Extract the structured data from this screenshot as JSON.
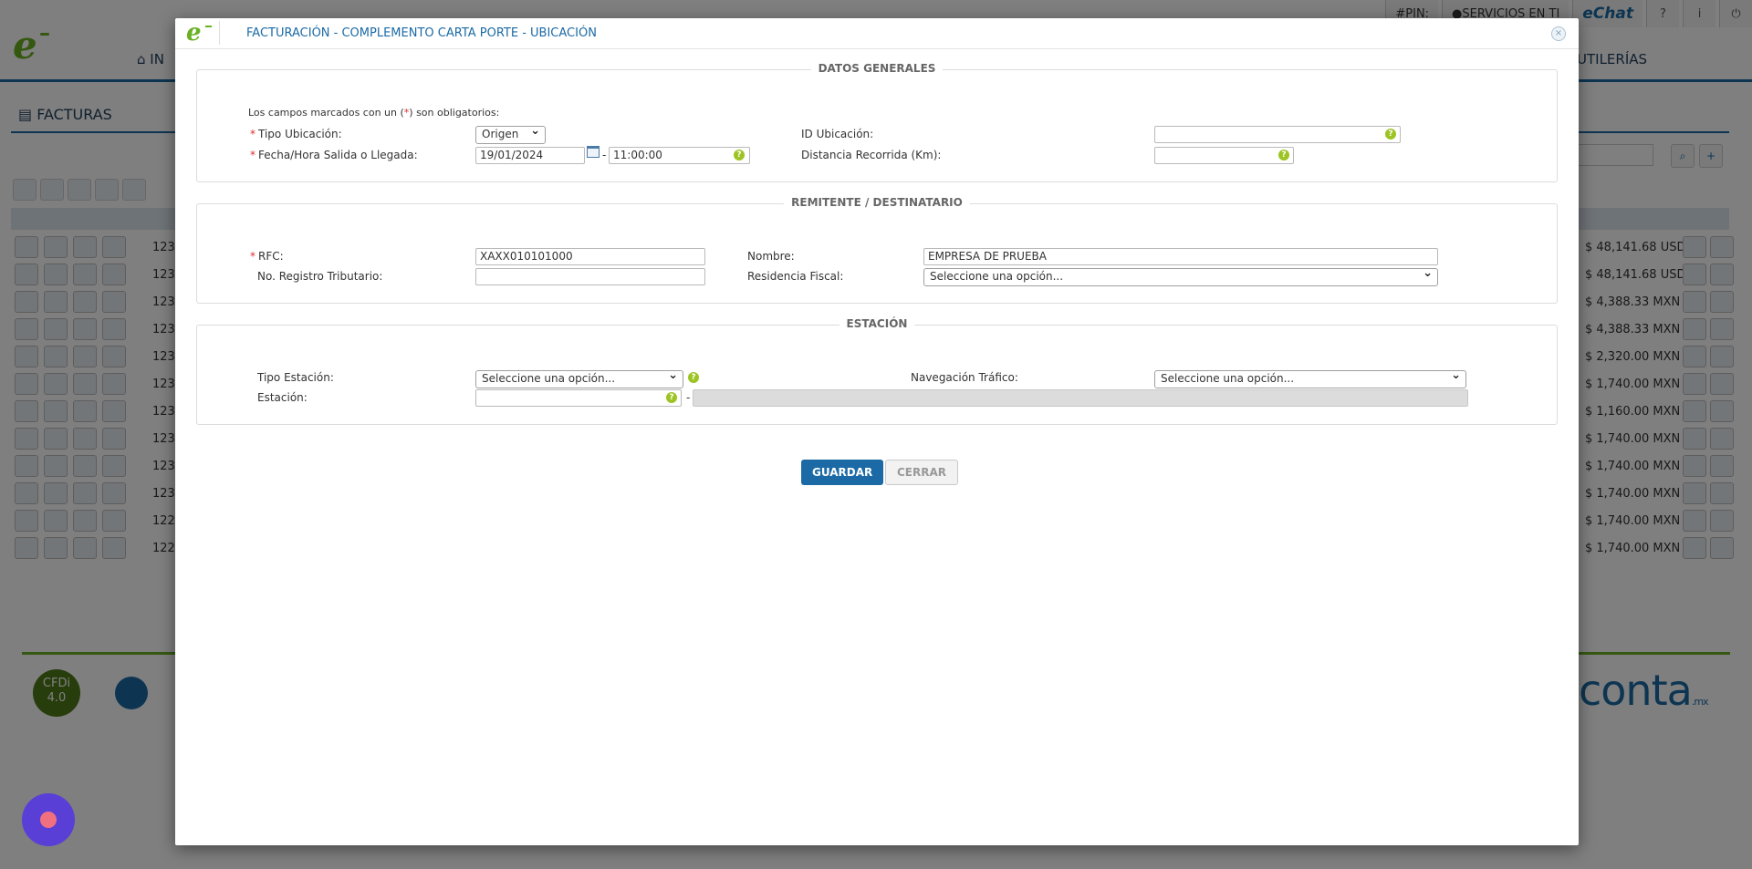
{
  "background": {
    "nav_home": "IN",
    "nav_util": "UTILERÍAS",
    "pin_label": "#PIN:",
    "servicios_label": "SERVICIOS EN TI",
    "echat_label": "eChat",
    "page_title": "FACTURAS",
    "cfdi_badge": "CFDi 4.0",
    "conta_logo": "conta",
    "conta_suffix": ".mx",
    "rows": [
      {
        "num": "123",
        "amount": "$ 48,141.68 USD"
      },
      {
        "num": "123",
        "amount": "$ 48,141.68 USD"
      },
      {
        "num": "123",
        "amount": "$ 4,388.33 MXN"
      },
      {
        "num": "123",
        "amount": "$ 4,388.33 MXN"
      },
      {
        "num": "123",
        "amount": "$ 2,320.00 MXN"
      },
      {
        "num": "123",
        "amount": "$ 1,740.00 MXN"
      },
      {
        "num": "123",
        "amount": "$ 1,160.00 MXN"
      },
      {
        "num": "123",
        "amount": "$ 1,740.00 MXN"
      },
      {
        "num": "123",
        "amount": "$ 1,740.00 MXN"
      },
      {
        "num": "123",
        "amount": "$ 1,740.00 MXN"
      },
      {
        "num": "122",
        "amount": "$ 1,740.00 MXN"
      },
      {
        "num": "122",
        "amount": "$ 1,740.00 MXN"
      }
    ]
  },
  "modal": {
    "title": "FACTURACIÓN - COMPLEMENTO CARTA PORTE - UBICACIÓN",
    "close_symbol": "×",
    "datos_generales": {
      "title": "DATOS GENERALES",
      "note_prefix": "Los campos marcados con un (",
      "note_star": "*",
      "note_suffix": ") son obligatorios:",
      "tipo_ubicacion_label": "Tipo Ubicación:",
      "tipo_ubicacion_value": "Origen",
      "fecha_label": "Fecha/Hora Salida o Llegada:",
      "fecha_value": "19/01/2024",
      "hora_value": "11:00:00",
      "id_ubicacion_label": "ID Ubicación:",
      "id_ubicacion_value": "",
      "distancia_label": "Distancia Recorrida (Km):",
      "distancia_value": ""
    },
    "remitente": {
      "title": "REMITENTE / DESTINATARIO",
      "rfc_label": "RFC:",
      "rfc_value": "XAXX010101000",
      "nombre_label": "Nombre:",
      "nombre_value": "EMPRESA DE PRUEBA",
      "registro_label": "No. Registro Tributario:",
      "registro_value": "",
      "residencia_label": "Residencia Fiscal:",
      "residencia_value": "Seleccione una opción..."
    },
    "estacion": {
      "title": "ESTACIÓN",
      "tipo_estacion_label": "Tipo Estación:",
      "tipo_estacion_value": "Seleccione una opción...",
      "navegacion_label": "Navegación Tráfico:",
      "navegacion_value": "Seleccione una opción...",
      "estacion_label": "Estación:",
      "estacion_value": "",
      "estacion_desc_value": ""
    },
    "buttons": {
      "guardar": "GUARDAR",
      "cerrar": "CERRAR"
    },
    "required_mark": "*",
    "dash": "-",
    "help_symbol": "?"
  },
  "colors": {
    "accent": "#1b6aa5",
    "brand_green": "#6ab022",
    "help_green": "#9dc423",
    "required_red": "#d9302c"
  }
}
